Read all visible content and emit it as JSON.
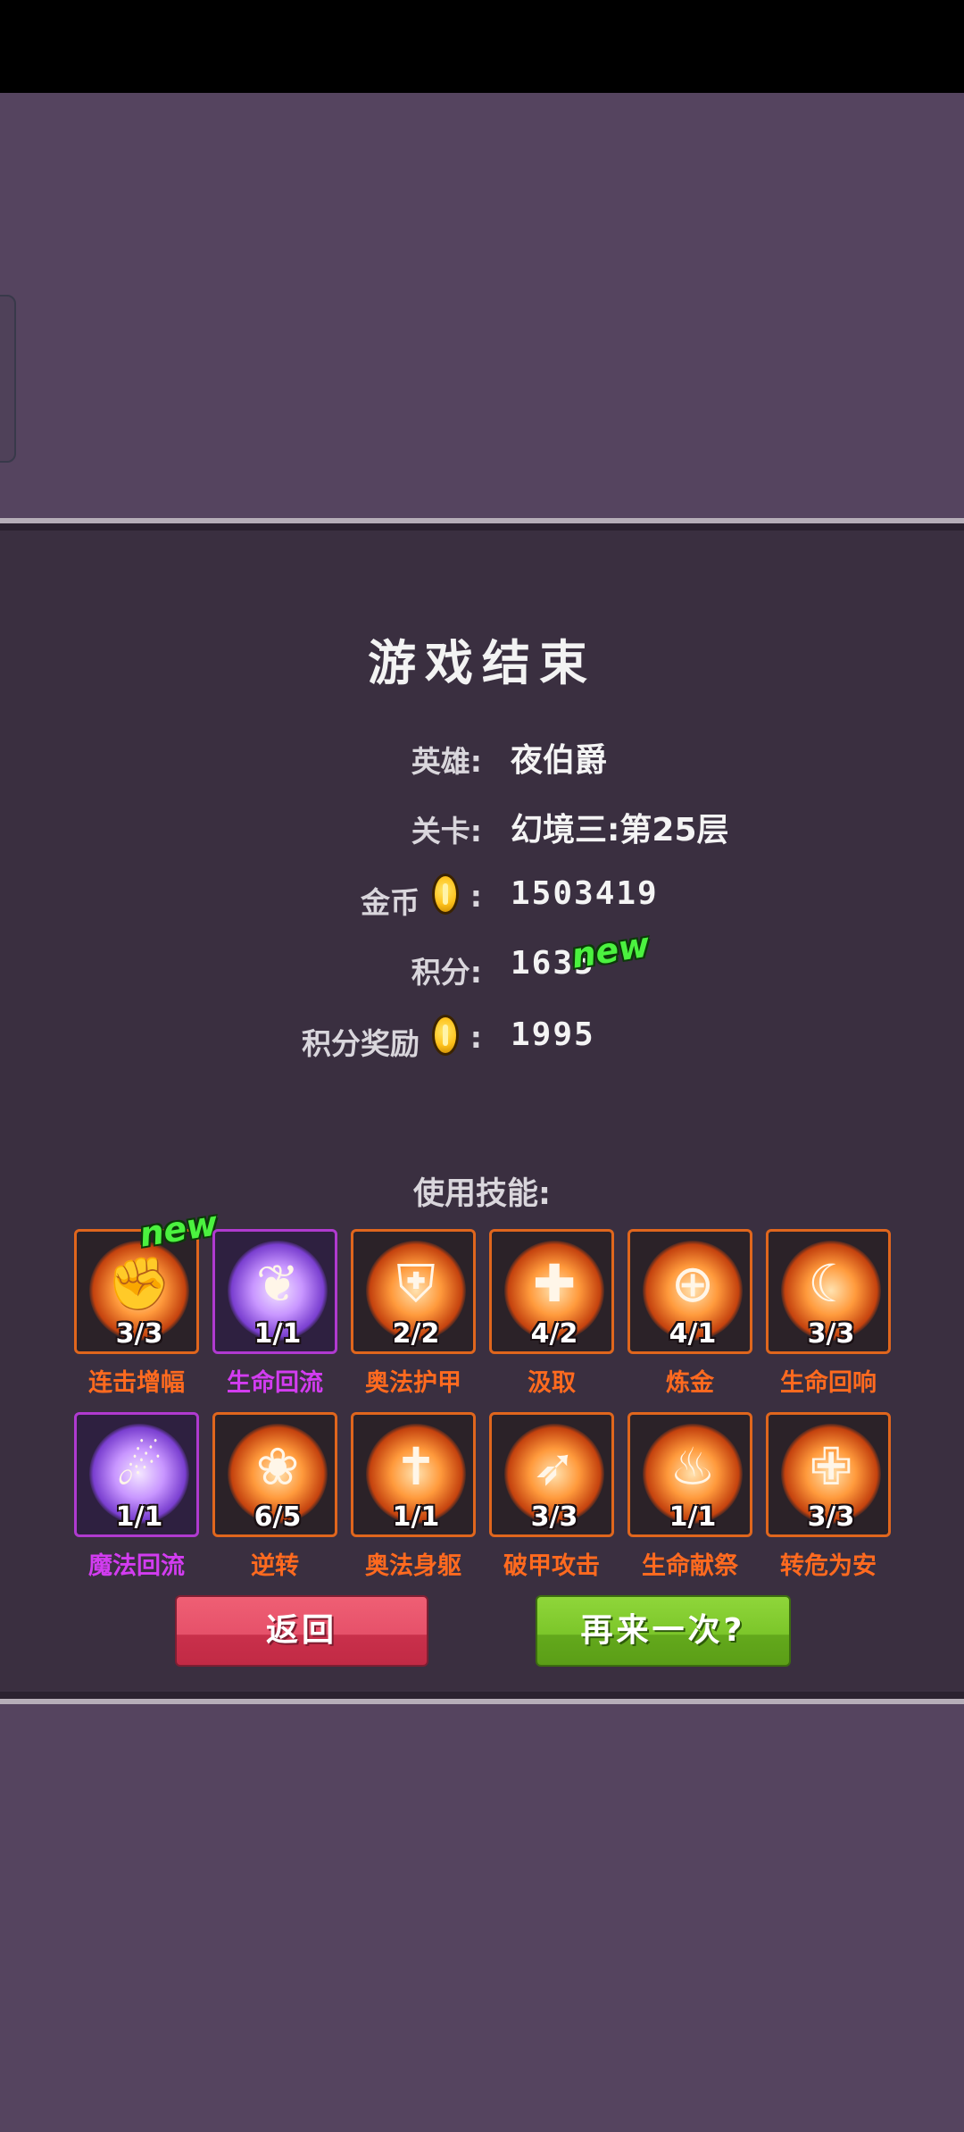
{
  "result": {
    "title": "游戏结束",
    "hero_label": "英雄:",
    "hero_value": "夜伯爵",
    "stage_label": "关卡:",
    "stage_value": "幻境三:第25层",
    "gold_label": "金币",
    "gold_colon": ":",
    "gold_value": "1503419",
    "score_label": "积分:",
    "score_value": "1635",
    "score_new_badge": "new",
    "reward_label": "积分奖励",
    "reward_colon": ":",
    "reward_value": "1995"
  },
  "skills": {
    "heading": "使用技能:",
    "new_badge": "new",
    "items": [
      {
        "name": "连击增幅",
        "count": "3/3",
        "icon": "combo-fist-icon",
        "color": "orange"
      },
      {
        "name": "生命回流",
        "count": "1/1",
        "icon": "life-flow-icon",
        "color": "purple"
      },
      {
        "name": "奥法护甲",
        "count": "2/2",
        "icon": "arcane-armor-icon",
        "color": "orange"
      },
      {
        "name": "汲取",
        "count": "4/2",
        "icon": "drain-cross-icon",
        "color": "orange"
      },
      {
        "name": "炼金",
        "count": "4/1",
        "icon": "alchemy-target-icon",
        "color": "orange"
      },
      {
        "name": "生命回响",
        "count": "3/3",
        "icon": "flexed-arm-icon",
        "color": "orange"
      },
      {
        "name": "魔法回流",
        "count": "1/1",
        "icon": "magic-flow-icon",
        "color": "purple"
      },
      {
        "name": "逆转",
        "count": "6/5",
        "icon": "reversal-icon",
        "color": "orange"
      },
      {
        "name": "奥法身躯",
        "count": "1/1",
        "icon": "winged-cross-icon",
        "color": "orange"
      },
      {
        "name": "破甲攻击",
        "count": "3/3",
        "icon": "armor-break-arrow-icon",
        "color": "orange"
      },
      {
        "name": "生命献祭",
        "count": "1/1",
        "icon": "flame-sacrifice-icon",
        "color": "orange"
      },
      {
        "name": "转危为安",
        "count": "3/3",
        "icon": "heal-runner-icon",
        "color": "orange"
      }
    ]
  },
  "buttons": {
    "back_label": "返回",
    "retry_label": "再来一次?"
  },
  "colors": {
    "background": "#55445f",
    "panel": "#3a2f40",
    "skill_orange": "#ff6a1f",
    "skill_purple": "#d23cf0",
    "new_badge": "#4bf23f",
    "back_button": "#e6516a",
    "retry_button": "#7cc62a"
  }
}
